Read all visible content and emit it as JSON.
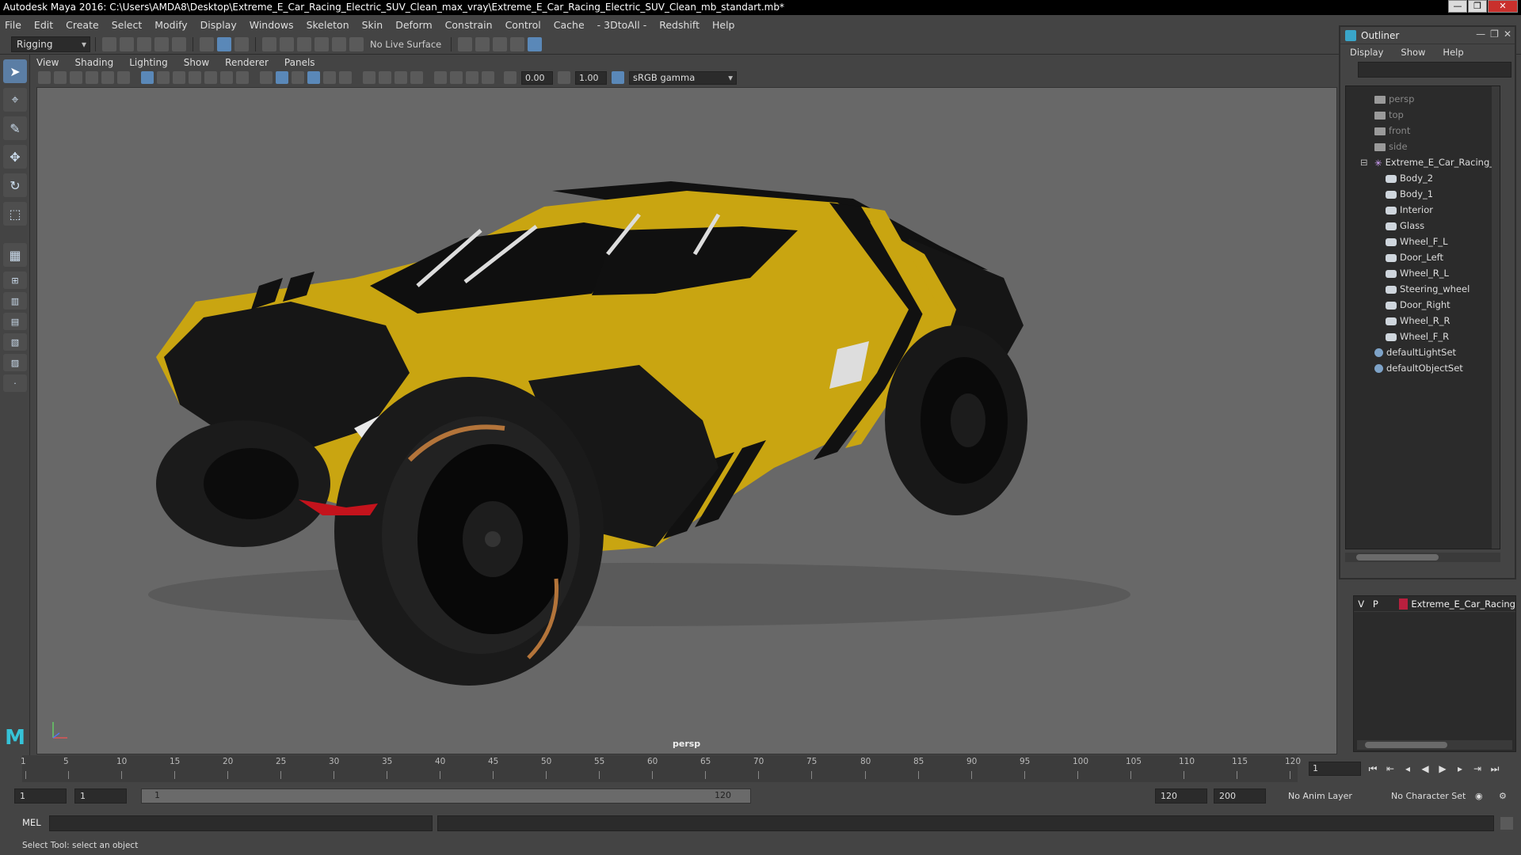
{
  "window": {
    "title": "Autodesk Maya 2016: C:\\Users\\AMDA8\\Desktop\\Extreme_E_Car_Racing_Electric_SUV_Clean_max_vray\\Extreme_E_Car_Racing_Electric_SUV_Clean_mb_standart.mb*",
    "min_label": "—",
    "max_label": "❐",
    "close_label": "✕"
  },
  "menus": [
    "File",
    "Edit",
    "Create",
    "Select",
    "Modify",
    "Display",
    "Windows",
    "Skeleton",
    "Skin",
    "Deform",
    "Constrain",
    "Control",
    "Cache",
    "- 3DtoAll -",
    "Redshift",
    "Help"
  ],
  "statusline": {
    "mode": "Rigging",
    "live_surface": "No Live Surface"
  },
  "panel": {
    "menus": [
      "View",
      "Shading",
      "Lighting",
      "Show",
      "Renderer",
      "Panels"
    ],
    "exposure": "0.00",
    "gamma": "1.00",
    "colorspace": "sRGB gamma",
    "camera_label": "persp"
  },
  "outliner": {
    "title": "Outliner",
    "menus": [
      "Display",
      "Show",
      "Help"
    ],
    "items": [
      {
        "label": "persp",
        "icon": "camera-icon",
        "indent": 1,
        "dim": true
      },
      {
        "label": "top",
        "icon": "camera-icon",
        "indent": 1,
        "dim": true
      },
      {
        "label": "front",
        "icon": "camera-icon",
        "indent": 1,
        "dim": true
      },
      {
        "label": "side",
        "icon": "camera-icon",
        "indent": 1,
        "dim": true
      },
      {
        "label": "Extreme_E_Car_Racing_Ele",
        "icon": "group-icon",
        "indent": 1,
        "dim": false
      },
      {
        "label": "Body_2",
        "icon": "mesh-icon",
        "indent": 2,
        "dim": false
      },
      {
        "label": "Body_1",
        "icon": "mesh-icon",
        "indent": 2,
        "dim": false
      },
      {
        "label": "Interior",
        "icon": "mesh-icon",
        "indent": 2,
        "dim": false
      },
      {
        "label": "Glass",
        "icon": "mesh-icon",
        "indent": 2,
        "dim": false
      },
      {
        "label": "Wheel_F_L",
        "icon": "mesh-icon",
        "indent": 2,
        "dim": false
      },
      {
        "label": "Door_Left",
        "icon": "mesh-icon",
        "indent": 2,
        "dim": false
      },
      {
        "label": "Wheel_R_L",
        "icon": "mesh-icon",
        "indent": 2,
        "dim": false
      },
      {
        "label": "Steering_wheel",
        "icon": "mesh-icon",
        "indent": 2,
        "dim": false
      },
      {
        "label": "Door_Right",
        "icon": "mesh-icon",
        "indent": 2,
        "dim": false
      },
      {
        "label": "Wheel_R_R",
        "icon": "mesh-icon",
        "indent": 2,
        "dim": false
      },
      {
        "label": "Wheel_F_R",
        "icon": "mesh-icon",
        "indent": 2,
        "dim": false
      },
      {
        "label": "defaultLightSet",
        "icon": "set-icon",
        "indent": 1,
        "dim": false
      },
      {
        "label": "defaultObjectSet",
        "icon": "set-icon",
        "indent": 1,
        "dim": false
      }
    ]
  },
  "layers": {
    "visible": "V",
    "playback": "P",
    "name": "Extreme_E_Car_Racing",
    "color": "#b8203e"
  },
  "timeline": {
    "ticks": [
      "5",
      "10",
      "15",
      "20",
      "25",
      "30",
      "35",
      "40",
      "45",
      "50",
      "55",
      "60",
      "65",
      "70",
      "75",
      "80",
      "85",
      "90",
      "95",
      "100",
      "105",
      "110",
      "115",
      "120"
    ],
    "first_tick": "1",
    "current_frame": "1"
  },
  "range": {
    "start": "1",
    "playback_start": "1",
    "slider_start": "1",
    "slider_end": "120",
    "playback_end": "120",
    "end": "200",
    "anim_layer": "No Anim Layer",
    "character_set": "No Character Set"
  },
  "mel": {
    "label": "MEL"
  },
  "help": {
    "text": "Select Tool: select an object"
  },
  "car": {
    "body_color": "#c9a511",
    "stripe_color": "#111111"
  }
}
